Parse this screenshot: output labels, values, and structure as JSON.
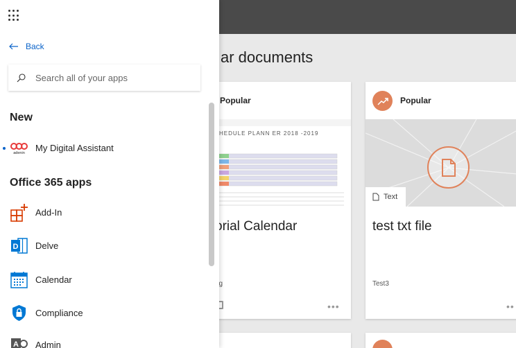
{
  "background": {
    "page_title": "ar documents",
    "cards": [
      {
        "label": "Popular",
        "sheet_title": "HEDULE PLANN  ER 2018 -2019",
        "small_tag": "d",
        "title": "orial Calendar",
        "subtitle": "ng",
        "more": "•••"
      },
      {
        "label": "Popular",
        "type": "Text",
        "title": "test txt file",
        "subtitle": "Test3",
        "more": "••"
      }
    ]
  },
  "panel": {
    "back_label": "Back",
    "search_placeholder": "Search all of your apps",
    "sections": {
      "new": "New",
      "office": "Office 365 apps"
    },
    "new_apps": [
      {
        "label": "My Digital Assistant",
        "icon": "adenin-logo",
        "logo_text": "adenin"
      }
    ],
    "office_apps": [
      {
        "label": "Add-In",
        "icon": "add-in-icon"
      },
      {
        "label": "Delve",
        "icon": "delve-icon"
      },
      {
        "label": "Calendar",
        "icon": "calendar-icon"
      },
      {
        "label": "Compliance",
        "icon": "compliance-icon"
      },
      {
        "label": "Admin",
        "icon": "admin-icon"
      }
    ]
  },
  "colors": {
    "accent": "#0a63c9",
    "orange": "#e0825a",
    "addin": "#d83b01",
    "delve": "#0078d4"
  }
}
